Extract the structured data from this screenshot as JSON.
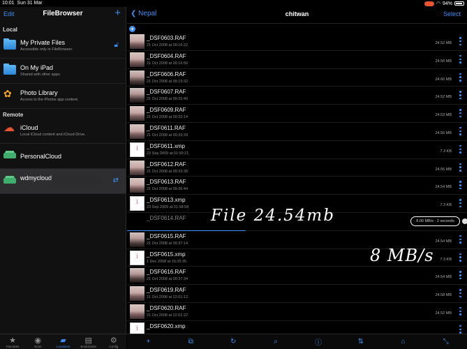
{
  "status": {
    "time": "10:01",
    "date": "Sun 31 Mar",
    "battery": "94%"
  },
  "sidebar": {
    "edit_label": "Edit",
    "title": "FileBrowser",
    "add_symbol": "+",
    "sections": {
      "local": "Local",
      "remote": "Remote"
    },
    "local_items": [
      {
        "name": "My Private Files",
        "sub": "Accessible only in FileBrowser."
      },
      {
        "name": "On My iPad",
        "sub": "Shared with other apps."
      },
      {
        "name": "Photo Library",
        "sub": "Access to the Photos app content."
      }
    ],
    "remote_items": [
      {
        "name": "iCloud",
        "sub": "Local iCloud content and iCloud Drive."
      },
      {
        "name": "PersonalCloud",
        "sub": ""
      },
      {
        "name": "wdmycloud",
        "sub": ""
      }
    ],
    "tabs": [
      {
        "label": "Favorites",
        "icon": "star-icon"
      },
      {
        "label": "Scan",
        "icon": "wifi-icon"
      },
      {
        "label": "Locations",
        "icon": "folder-icon"
      },
      {
        "label": "Bookmarks",
        "icon": "book-icon"
      },
      {
        "label": "Config",
        "icon": "gear-icon"
      }
    ]
  },
  "main": {
    "back_label": "Nepal",
    "title": "chitwan",
    "select_label": "Select",
    "files": [
      {
        "name": "_DSF0603.RAF",
        "date": "21 Oct 2008 at 09:16:22",
        "size": "24.52 MB",
        "kind": "photo"
      },
      {
        "name": "_DSF0604.RAF",
        "date": "21 Oct 2008 at 09:16:56",
        "size": "24.50 MB",
        "kind": "photo"
      },
      {
        "name": "_DSF0606.RAF",
        "date": "21 Oct 2008 at 09:19:32",
        "size": "24.60 MB",
        "kind": "dark"
      },
      {
        "name": "_DSF0607.RAF",
        "date": "21 Oct 2008 at 09:25:40",
        "size": "24.52 MB",
        "kind": "dark"
      },
      {
        "name": "_DSF0609.RAF",
        "date": "21 Oct 2008 at 09:32:14",
        "size": "24.53 MB",
        "kind": "photo"
      },
      {
        "name": "_DSF0611.RAF",
        "date": "21 Oct 2008 at 09:33:34",
        "size": "24.55 MB",
        "kind": "photo"
      },
      {
        "name": "_DSF0611.xmp",
        "date": "23 Sep 2009 at 01:59:21",
        "size": "7.3 KB",
        "kind": "xmp"
      },
      {
        "name": "_DSF0612.RAF",
        "date": "21 Oct 2008 at 09:33:38",
        "size": "24.55 MB",
        "kind": "photo"
      },
      {
        "name": "_DSF0613.RAF",
        "date": "21 Oct 2008 at 09:36:44",
        "size": "24.54 MB",
        "kind": "photo"
      },
      {
        "name": "_DSF0613.xmp",
        "date": "23 Sep 2009 at 01:58:58",
        "size": "7.3 KB",
        "kind": "xmp"
      },
      {
        "name": "_DSF0614.RAF",
        "date": "",
        "size": "",
        "kind": "none",
        "downloading": true,
        "speed": "8.00 MB/s - 2 seconds"
      },
      {
        "name": "_DSF0615.RAF",
        "date": "21 Oct 2008 at 09:37:14",
        "size": "24.54 MB",
        "kind": "dark"
      },
      {
        "name": "_DSF0615.xmp",
        "date": "1 Dec 2008 at 15:35:35",
        "size": "7.3 KB",
        "kind": "xmp"
      },
      {
        "name": "_DSF0616.RAF",
        "date": "21 Oct 2008 at 09:37:34",
        "size": "24.54 MB",
        "kind": "dark"
      },
      {
        "name": "_DSF0619.RAF",
        "date": "21 Oct 2008 at 22:01:12",
        "size": "24.58 MB",
        "kind": "photo"
      },
      {
        "name": "_DSF0620.RAF",
        "date": "21 Oct 2008 at 22:02:22",
        "size": "24.52 MB",
        "kind": "photo"
      },
      {
        "name": "_DSF0620.xmp",
        "date": "",
        "size": "",
        "kind": "xmp"
      }
    ],
    "toolbar_icons": [
      "plus-icon",
      "move-icon",
      "refresh-icon",
      "search-icon",
      "info-icon",
      "sort-icon",
      "home-icon",
      "expand-icon"
    ]
  },
  "annotations": {
    "file_note": "File 24.54mb",
    "speed_note": "8 MB/s"
  },
  "colors": {
    "accent": "#3d8ff5",
    "background": "#000000",
    "sidebar": "#111111"
  }
}
